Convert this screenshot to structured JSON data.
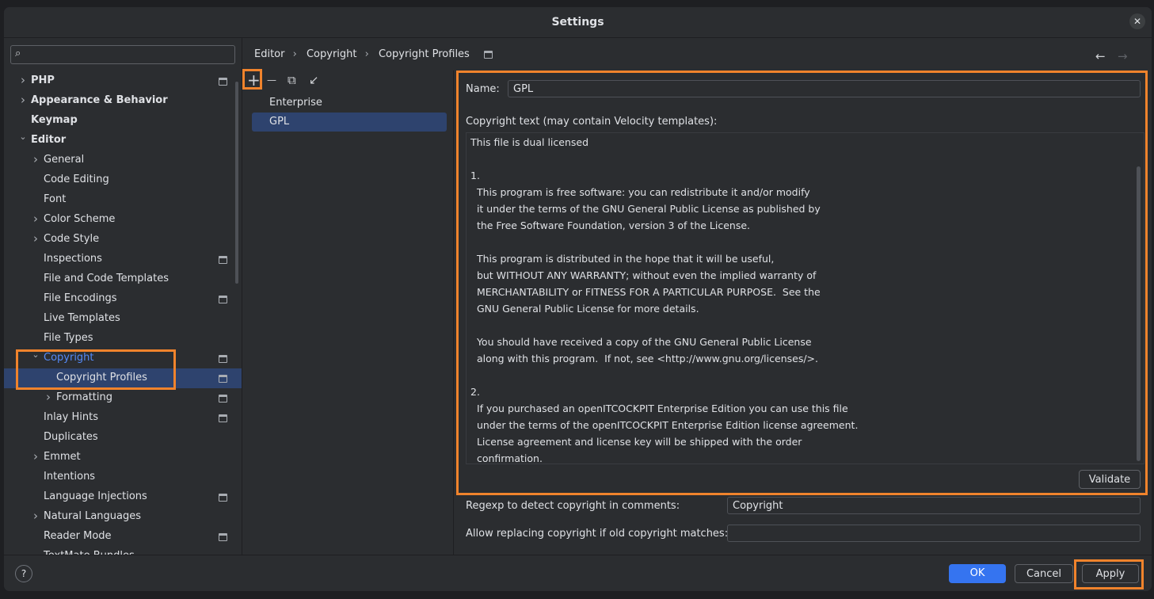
{
  "window": {
    "title": "Settings",
    "close_glyph": "✕"
  },
  "search": {
    "icon": "search-icon",
    "glyph": "⌕",
    "placeholder": ""
  },
  "tree": [
    {
      "label": "PHP",
      "level": 0,
      "chevron": ">",
      "bold": true,
      "pin": true
    },
    {
      "label": "Appearance & Behavior",
      "level": 0,
      "chevron": ">",
      "bold": true,
      "pin": false
    },
    {
      "label": "Keymap",
      "level": 0,
      "chevron": "",
      "bold": true,
      "pin": false
    },
    {
      "label": "Editor",
      "level": 0,
      "chevron": "v",
      "bold": true,
      "pin": false
    },
    {
      "label": "General",
      "level": 1,
      "chevron": ">",
      "bold": false,
      "pin": false
    },
    {
      "label": "Code Editing",
      "level": 1,
      "chevron": "",
      "bold": false,
      "pin": false
    },
    {
      "label": "Font",
      "level": 1,
      "chevron": "",
      "bold": false,
      "pin": false
    },
    {
      "label": "Color Scheme",
      "level": 1,
      "chevron": ">",
      "bold": false,
      "pin": false
    },
    {
      "label": "Code Style",
      "level": 1,
      "chevron": ">",
      "bold": false,
      "pin": false
    },
    {
      "label": "Inspections",
      "level": 1,
      "chevron": "",
      "bold": false,
      "pin": true
    },
    {
      "label": "File and Code Templates",
      "level": 1,
      "chevron": "",
      "bold": false,
      "pin": false
    },
    {
      "label": "File Encodings",
      "level": 1,
      "chevron": "",
      "bold": false,
      "pin": true
    },
    {
      "label": "Live Templates",
      "level": 1,
      "chevron": "",
      "bold": false,
      "pin": false
    },
    {
      "label": "File Types",
      "level": 1,
      "chevron": "",
      "bold": false,
      "pin": false
    },
    {
      "label": "Copyright",
      "level": 1,
      "chevron": "v",
      "bold": false,
      "pin": true,
      "link": true
    },
    {
      "label": "Copyright Profiles",
      "level": 2,
      "chevron": "",
      "bold": false,
      "pin": true,
      "selected": true
    },
    {
      "label": "Formatting",
      "level": 2,
      "chevron": ">",
      "bold": false,
      "pin": true
    },
    {
      "label": "Inlay Hints",
      "level": 1,
      "chevron": "",
      "bold": false,
      "pin": true
    },
    {
      "label": "Duplicates",
      "level": 1,
      "chevron": "",
      "bold": false,
      "pin": false
    },
    {
      "label": "Emmet",
      "level": 1,
      "chevron": ">",
      "bold": false,
      "pin": false
    },
    {
      "label": "Intentions",
      "level": 1,
      "chevron": "",
      "bold": false,
      "pin": false
    },
    {
      "label": "Language Injections",
      "level": 1,
      "chevron": "",
      "bold": false,
      "pin": true
    },
    {
      "label": "Natural Languages",
      "level": 1,
      "chevron": ">",
      "bold": false,
      "pin": false
    },
    {
      "label": "Reader Mode",
      "level": 1,
      "chevron": "",
      "bold": false,
      "pin": true
    },
    {
      "label": "TextMate Bundles",
      "level": 1,
      "chevron": "",
      "bold": false,
      "pin": false
    }
  ],
  "breadcrumb": {
    "items": [
      "Editor",
      "Copyright",
      "Copyright Profiles"
    ],
    "separator": "›",
    "back": "←",
    "forward": "→"
  },
  "profiles_toolbar": {
    "add": "+",
    "remove": "—",
    "copy": "⧉",
    "import": "↙"
  },
  "profiles": [
    {
      "label": "Enterprise",
      "selected": false
    },
    {
      "label": "GPL",
      "selected": true
    }
  ],
  "form": {
    "name_label": "Name:",
    "name_value": "GPL",
    "copyright_text_label": "Copyright text (may contain Velocity templates):",
    "copyright_lines": [
      "This file is dual licensed",
      "",
      "1.",
      "  This program is free software: you can redistribute it and/or modify",
      "  it under the terms of the GNU General Public License as published by",
      "  the Free Software Foundation, version 3 of the License.",
      "",
      "  This program is distributed in the hope that it will be useful,",
      "  but WITHOUT ANY WARRANTY; without even the implied warranty of",
      "  MERCHANTABILITY or FITNESS FOR A PARTICULAR PURPOSE.  See the",
      "  GNU General Public License for more details.",
      "",
      "  You should have received a copy of the GNU General Public License",
      "  along with this program.  If not, see <http://www.gnu.org/licenses/>.",
      "",
      "2.",
      "  If you purchased an openITCOCKPIT Enterprise Edition you can use this file",
      "  under the terms of the openITCOCKPIT Enterprise Edition license agreement.",
      "  License agreement and license key will be shipped with the order",
      "  confirmation."
    ],
    "validate_label": "Validate",
    "regexp_label": "Regexp to detect copyright in comments:",
    "regexp_value": "Copyright",
    "allow_replace_label": "Allow replacing copyright if old copyright matches:",
    "allow_replace_value": ""
  },
  "buttons": {
    "help": "?",
    "ok": "OK",
    "cancel": "Cancel",
    "apply": "Apply"
  },
  "colors": {
    "accent": "#3574f0",
    "highlight": "#f0832c",
    "selection": "#2e436e",
    "background": "#2b2d30"
  }
}
